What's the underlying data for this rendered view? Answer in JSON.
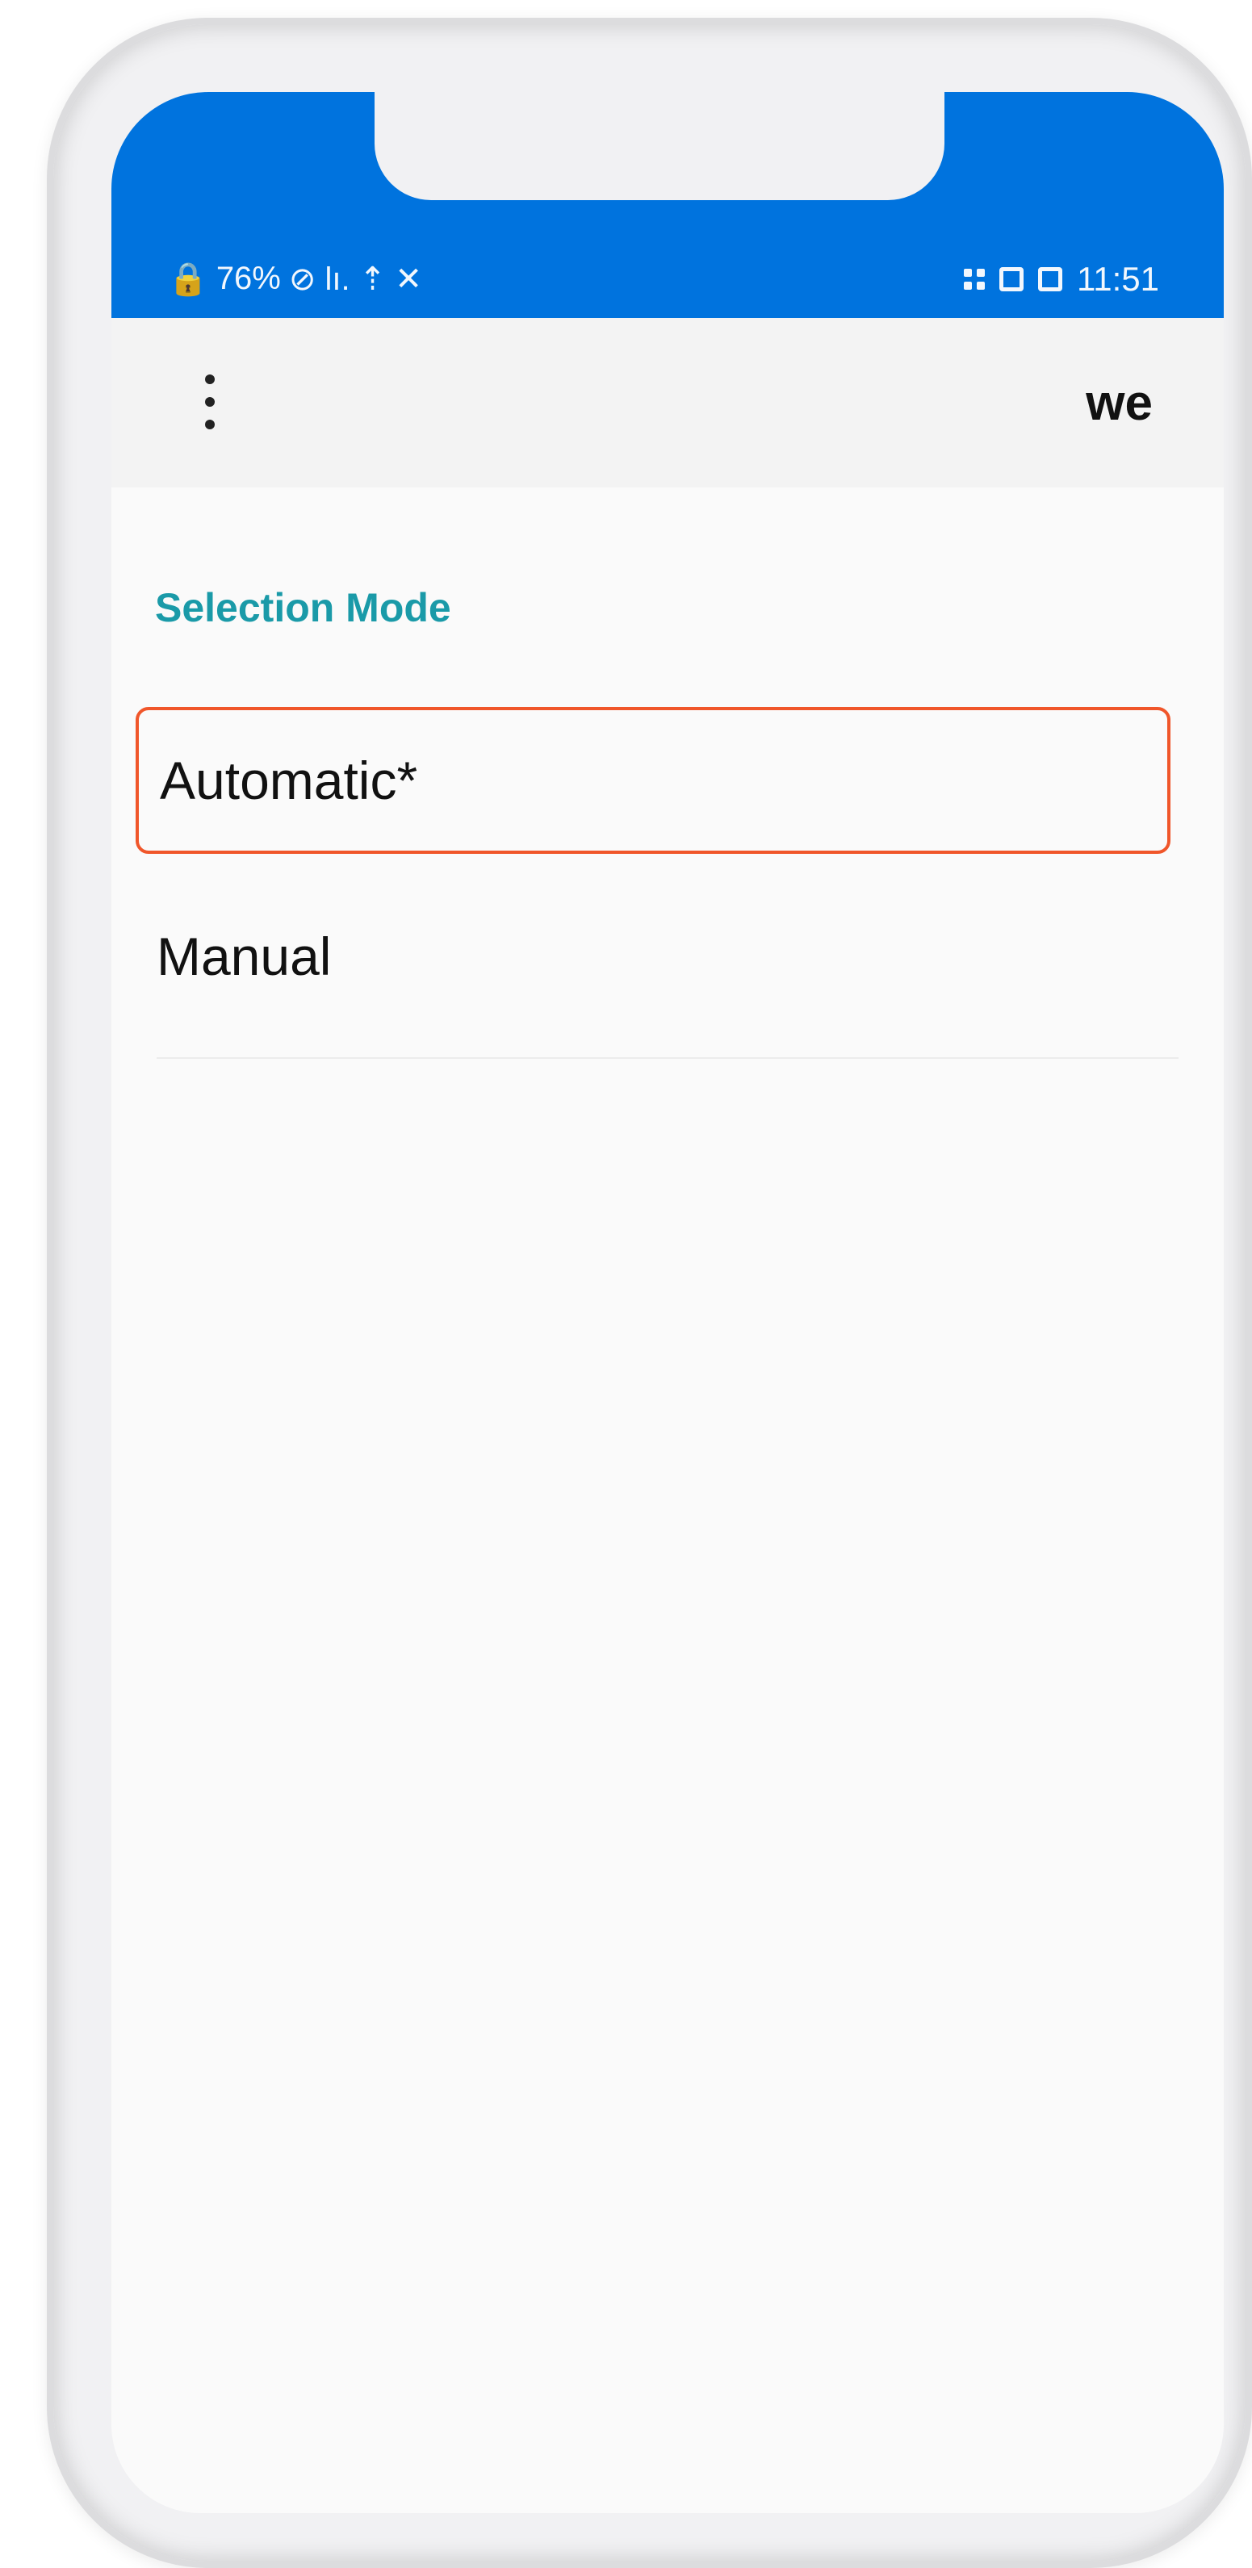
{
  "status_bar": {
    "battery": "76%",
    "left_icons": "⊘ lı. ⇡ ✕",
    "time": "11:51"
  },
  "app_bar": {
    "title": "we"
  },
  "section": {
    "header": "Selection Mode"
  },
  "options": [
    {
      "label": "Automatic*"
    },
    {
      "label": "Manual"
    }
  ],
  "colors": {
    "status_bar": "#0073de",
    "section_header": "#1a9aa8",
    "highlight_border": "#f0562a"
  }
}
